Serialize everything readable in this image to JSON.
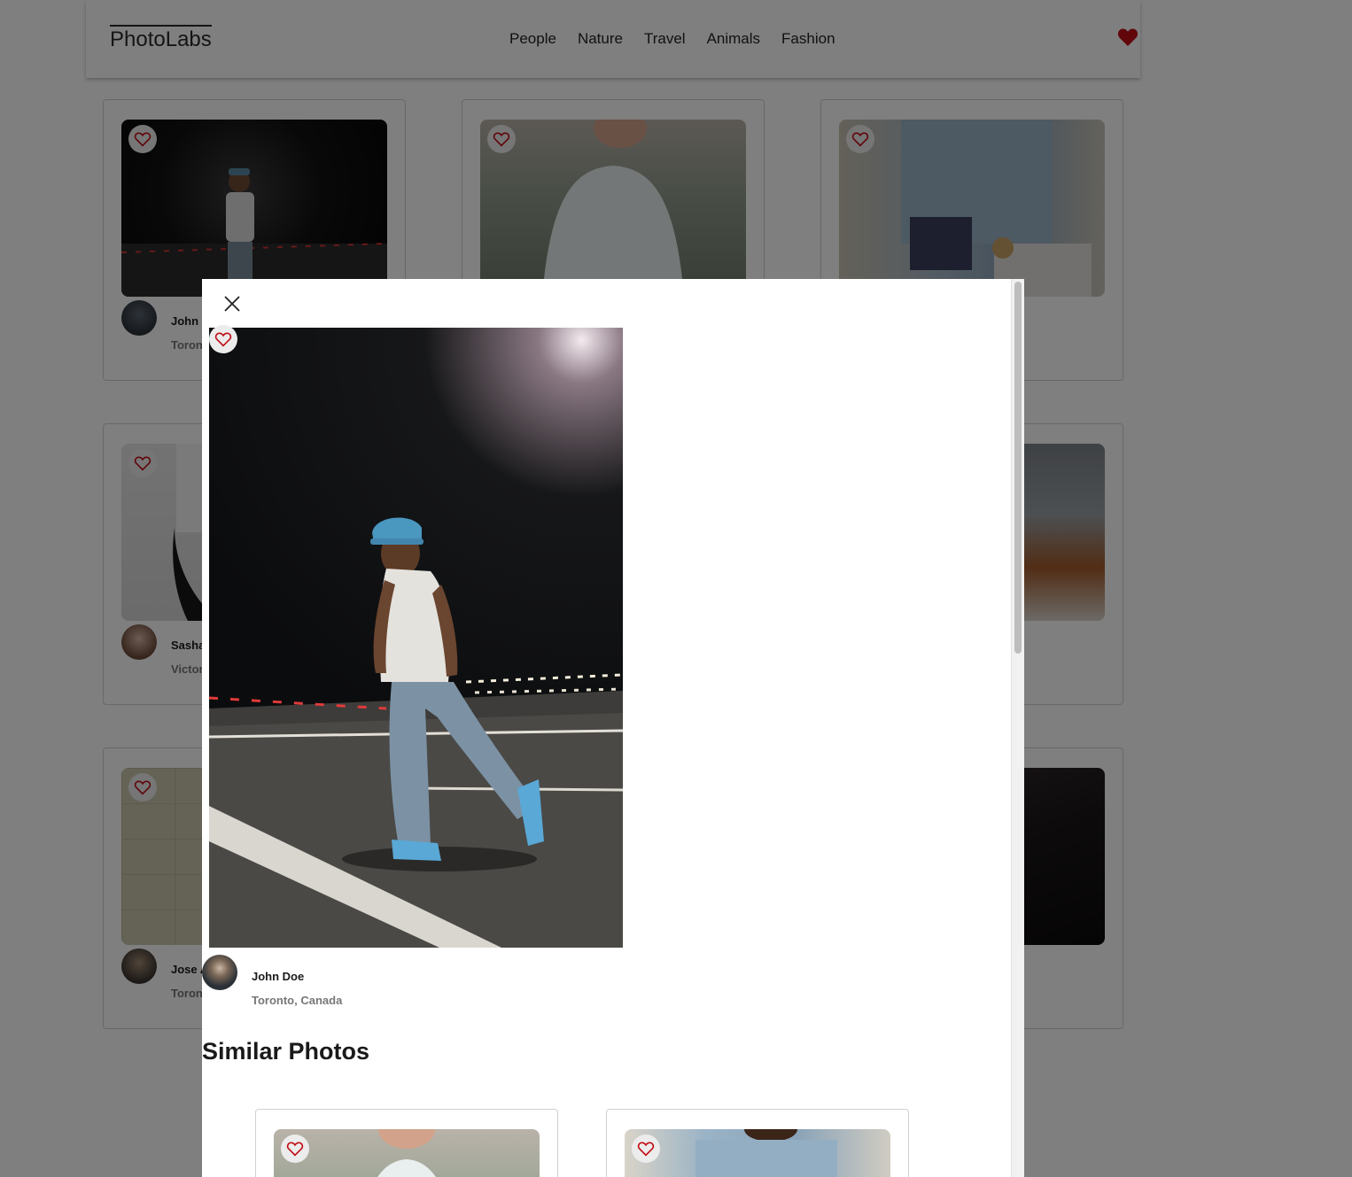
{
  "app": {
    "logo": "PhotoLabs"
  },
  "nav": {
    "topics": [
      "People",
      "Nature",
      "Travel",
      "Animals",
      "Fashion"
    ],
    "favorites_icon": "heart-filled-icon"
  },
  "grid": {
    "cards": [
      {
        "user": "John Doe",
        "location": "Toronto, Canada",
        "photo": "man-night-street-photo"
      },
      {
        "user": "",
        "location": "",
        "photo": "woman-white-top-photo"
      },
      {
        "user": "",
        "location": "",
        "photo": "man-denim-shirt-photo"
      },
      {
        "user": "Sasha Mika",
        "location": "Victoria, Canada",
        "photo": "white-socks-loafers-photo"
      },
      {
        "user": "",
        "location": "",
        "photo": "coastal-rocks-photo"
      },
      {
        "user": "Jose A",
        "location": "Toronto",
        "photo": "tile-wall-photo"
      },
      {
        "user": "",
        "location": "",
        "photo": "dark-interior-photo"
      }
    ]
  },
  "modal": {
    "close_icon": "close-icon",
    "user": "John Doe",
    "location": "Toronto, Canada",
    "similar_title": "Similar Photos"
  },
  "colors": {
    "heart": "#c20d17",
    "overlay": "rgba(0,0,0,0.5)"
  }
}
